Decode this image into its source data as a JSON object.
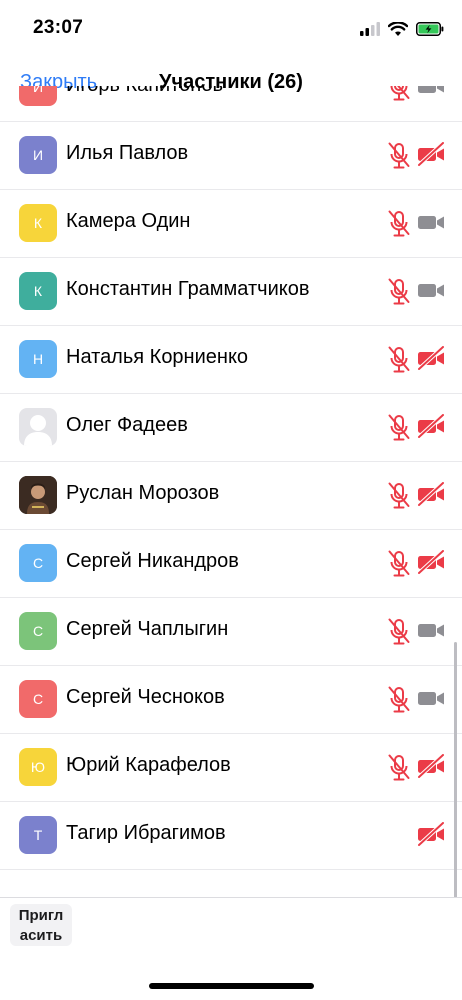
{
  "status_bar": {
    "time": "23:07"
  },
  "nav": {
    "close_label": "Закрыть",
    "title": "Участники (26)"
  },
  "participants": [
    {
      "initial": "И",
      "name": "Игорь Капитонов",
      "avatar_color": "#f16a6a",
      "mic_muted": true,
      "video_off": false
    },
    {
      "initial": "И",
      "name": "Илья Павлов",
      "avatar_color": "#7b81cd",
      "mic_muted": true,
      "video_off": true
    },
    {
      "initial": "К",
      "name": "Камера Один",
      "avatar_color": "#f7d53a",
      "mic_muted": true,
      "video_off": false
    },
    {
      "initial": "К",
      "name": "Константин Грамматчиков",
      "avatar_color": "#3fae9d",
      "mic_muted": true,
      "video_off": false
    },
    {
      "initial": "Н",
      "name": "Наталья Корниенко",
      "avatar_color": "#63b3f3",
      "mic_muted": true,
      "video_off": true
    },
    {
      "initial": "",
      "name": "Олег Фадеев",
      "avatar_color": "#e4e4e8",
      "avatar_type": "placeholder",
      "mic_muted": true,
      "video_off": true
    },
    {
      "initial": "",
      "name": "Руслан Морозов",
      "avatar_color": "#4a3a30",
      "avatar_type": "photo",
      "mic_muted": true,
      "video_off": true
    },
    {
      "initial": "С",
      "name": "Сергей Никандров",
      "avatar_color": "#63b3f3",
      "mic_muted": true,
      "video_off": true
    },
    {
      "initial": "С",
      "name": "Сергей Чаплыгин",
      "avatar_color": "#7cc47a",
      "mic_muted": true,
      "video_off": false
    },
    {
      "initial": "С",
      "name": "Сергей Чесноков",
      "avatar_color": "#f16a6a",
      "mic_muted": true,
      "video_off": false
    },
    {
      "initial": "Ю",
      "name": "Юрий Карафелов",
      "avatar_color": "#f7d53a",
      "mic_muted": true,
      "video_off": true
    },
    {
      "initial": "Т",
      "name": "Тагир Ибрагимов",
      "avatar_color": "#7b81cd",
      "mic_muted": false,
      "video_off": true
    }
  ],
  "footer": {
    "invite_label": "Пригл асить"
  },
  "colors": {
    "accent": "#2f7cf6",
    "muted_red": "#eb3b47",
    "camera_gray": "#8e8e93"
  }
}
